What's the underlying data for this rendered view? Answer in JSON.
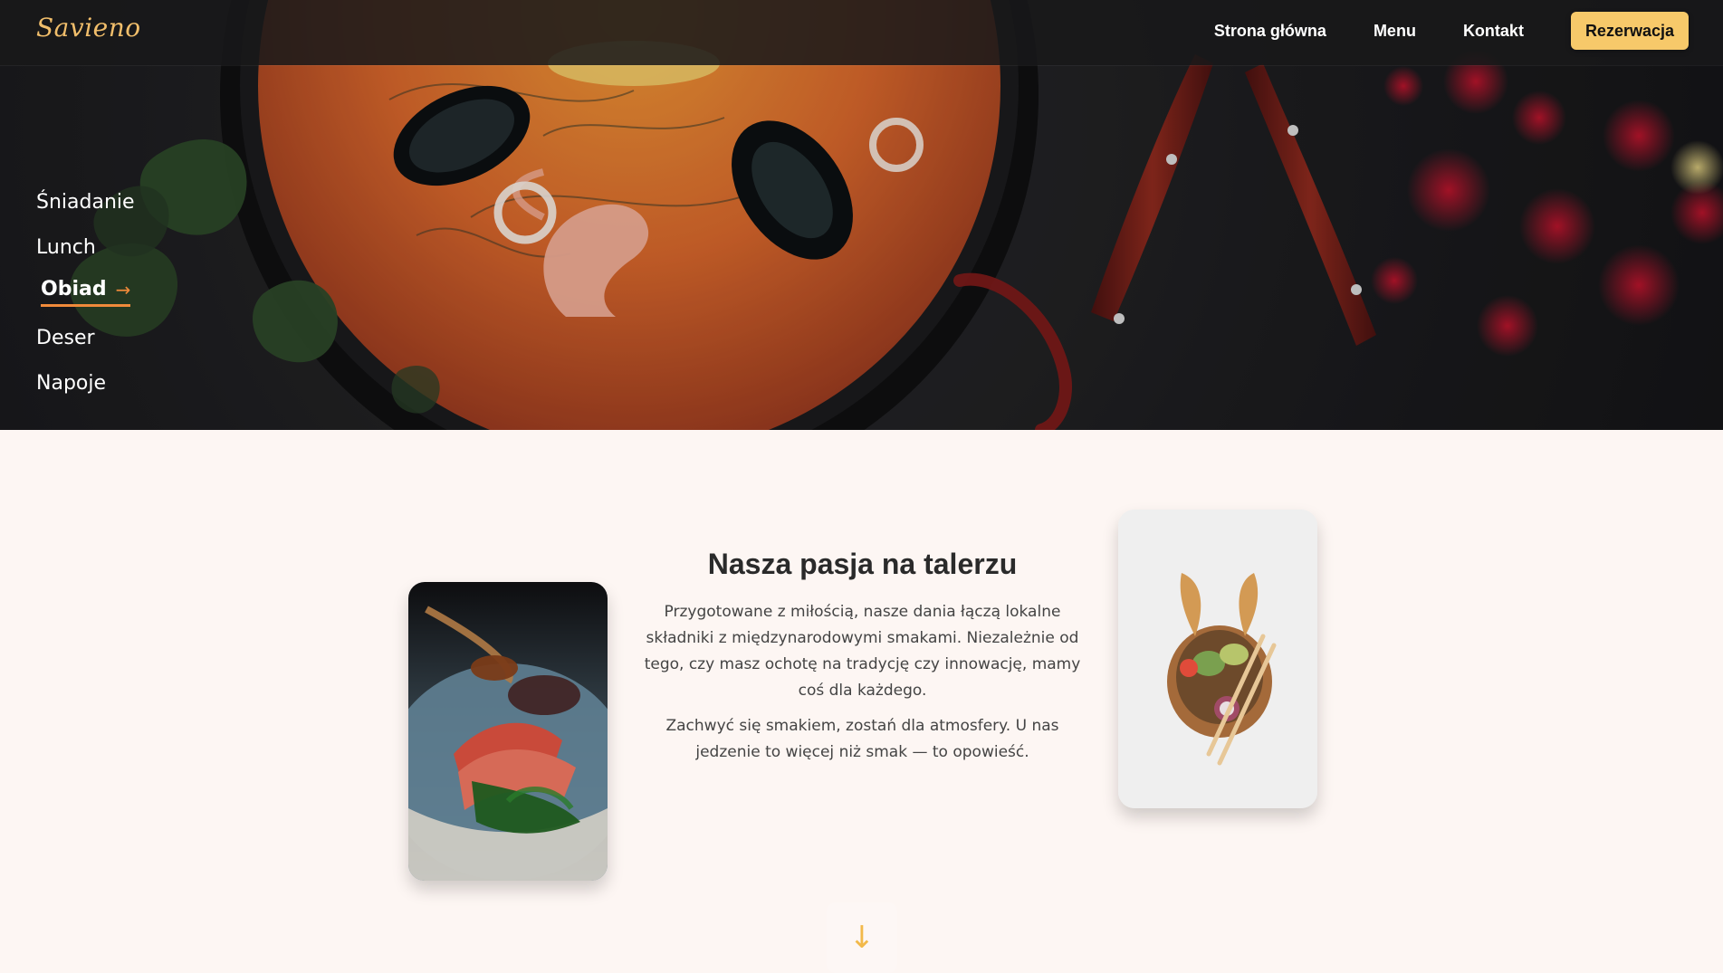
{
  "brand": {
    "logo_text": "Savieno",
    "accent_color": "#f7c96a",
    "accent_orange": "#f08a3a"
  },
  "header": {
    "nav": [
      {
        "label": "Strona główna"
      },
      {
        "label": "Menu"
      },
      {
        "label": "Kontakt"
      }
    ],
    "cta_label": "Rezerwacja"
  },
  "hero": {
    "categories": [
      {
        "label": "Śniadanie"
      },
      {
        "label": "Lunch"
      },
      {
        "label": "Obiad",
        "arrow": "→"
      },
      {
        "label": "Deser"
      },
      {
        "label": "Napoje"
      }
    ]
  },
  "section": {
    "title": "Nasza pasja na talerzu",
    "paragraph_1": "Przygotowane z miłością, nasze dania łączą lokalne składniki z międzynarodowymi smakami. Niezależnie od tego, czy masz ochotę na tradycję czy innowację, mamy coś dla każdego.",
    "paragraph_2": "Zachwyć się smakiem, zostań dla atmosfery. U nas jedzenie to więcej niż smak — to opowieść.",
    "down_arrow_icon": "↓"
  }
}
